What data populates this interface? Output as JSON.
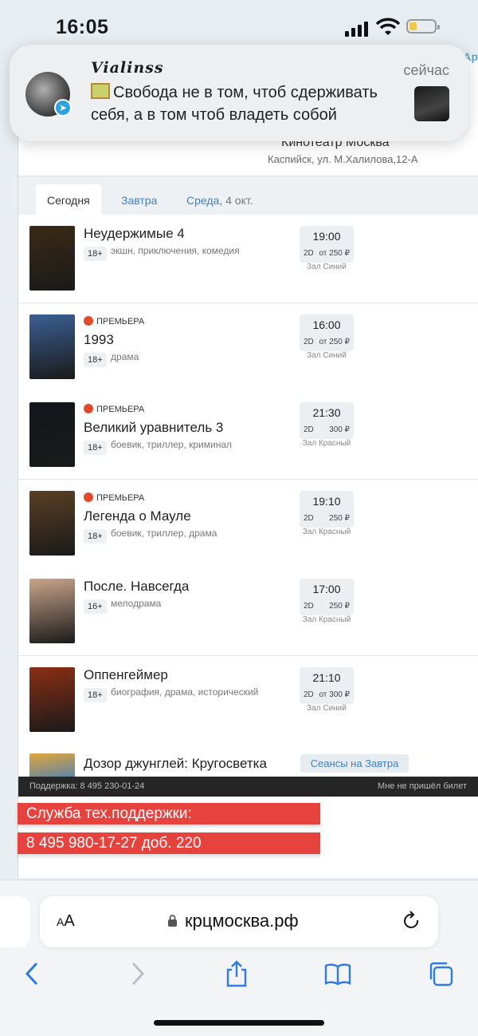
{
  "status_bar": {
    "time": "16:05"
  },
  "notification": {
    "sender": "Vialinss",
    "time": "сейчас",
    "message": "Свобода не в том, чтоб сдерживать себя, а в том чтоб владеть собой",
    "app_icon": "telegram-icon"
  },
  "cinema": {
    "name": "Кинотеатр Москва",
    "address": "Каспийск, ул. М.Халилова,12-А"
  },
  "tabs": {
    "today": "Сегодня",
    "tomorrow": "Завтра",
    "wednesday": "Среда,",
    "wednesday_date": "4 окт."
  },
  "premiere_label": "ПРЕМЬЕРА",
  "movies": [
    {
      "title": "Неудержимые 4",
      "age": "18+",
      "genres": "экшн, приключения, комедия",
      "premiere": false,
      "time": "19:00",
      "format": "2D",
      "price": "от 250 ₽",
      "hall": "Зал Синий",
      "poster_color": "#3a2a16"
    },
    {
      "title": "1993",
      "age": "18+",
      "genres": "драма",
      "premiere": true,
      "time": "16:00",
      "format": "2D",
      "price": "от 250 ₽",
      "hall": "Зал Синий",
      "poster_color": "#3b5f92"
    },
    {
      "title": "Великий уравнитель 3",
      "age": "18+",
      "genres": "боевик, триллер, криминал",
      "premiere": true,
      "time": "21:30",
      "format": "2D",
      "price": "300 ₽",
      "hall": "Зал Красный",
      "poster_color": "#12171b"
    },
    {
      "title": "Легенда о Мауле",
      "age": "18+",
      "genres": "боевик, триллер, драма",
      "premiere": true,
      "time": "19:10",
      "format": "2D",
      "price": "250 ₽",
      "hall": "Зал Красный",
      "poster_color": "#5a3f25"
    },
    {
      "title": "После. Навсегда",
      "age": "16+",
      "genres": "мелодрама",
      "premiere": false,
      "time": "17:00",
      "format": "2D",
      "price": "250 ₽",
      "hall": "Зал Красный",
      "poster_color": "#c9a58a"
    },
    {
      "title": "Оппенгеймер",
      "age": "18+",
      "genres": "биография, драма, исторический",
      "premiere": false,
      "time": "21:10",
      "format": "2D",
      "price": "от 300 ₽",
      "hall": "Зал Синий",
      "poster_color": "#8a2f14"
    }
  ],
  "last_movie": {
    "title": "Дозор джунглей: Кругосветка",
    "button": "Сеансы на Завтра",
    "poster_color": "#e2a63a"
  },
  "footer": {
    "support_phone": "Поддержка: 8 495 230-01-24",
    "no_ticket": "Мне не пришёл билет"
  },
  "support_banner": {
    "line1": "Служба тех.поддержки:",
    "line2": "8 495 980-17-27 доб. 220"
  },
  "browser": {
    "text_size": "AA",
    "url": "крцмосква.рф"
  }
}
